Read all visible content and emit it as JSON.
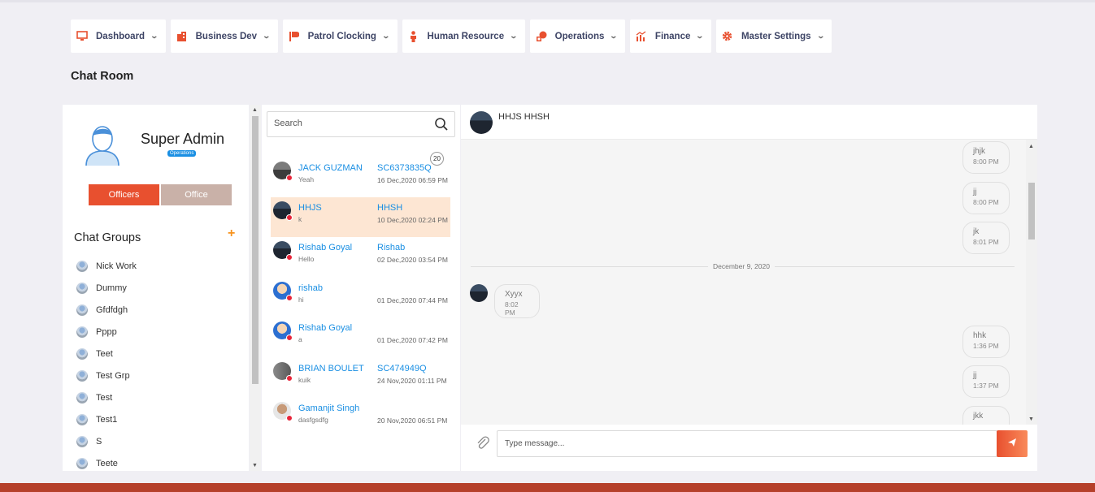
{
  "nav": [
    {
      "label": "Dashboard",
      "icon": "monitor-icon"
    },
    {
      "label": "Business Dev",
      "icon": "building-icon"
    },
    {
      "label": "Patrol Clocking",
      "icon": "flag-icon"
    },
    {
      "label": "Human Resource",
      "icon": "person-icon"
    },
    {
      "label": "Operations",
      "icon": "operations-icon"
    },
    {
      "label": "Finance",
      "icon": "chart-icon"
    },
    {
      "label": "Master Settings",
      "icon": "gear-icon"
    }
  ],
  "page_title": "Chat Room",
  "profile": {
    "name": "Super Admin",
    "role": "Operations"
  },
  "tabs": {
    "officers": "Officers",
    "office": "Office"
  },
  "groups": {
    "title": "Chat Groups",
    "add": "+",
    "items": [
      "Nick Work",
      "Dummy",
      "Gfdfdgh",
      "Pppp",
      "Teet",
      "Test Grp",
      "Test",
      "Test1",
      "S",
      "Teete"
    ]
  },
  "search": {
    "placeholder": "Search"
  },
  "contacts": [
    {
      "name": "JACK GUZMAN",
      "id": "SC6373835Q",
      "msg": "Yeah",
      "date": "16 Dec,2020 06:59 PM",
      "badge": "20"
    },
    {
      "name": "HHJS",
      "id": "HHSH",
      "msg": "k",
      "date": "10 Dec,2020 02:24 PM"
    },
    {
      "name": "Rishab Goyal",
      "id": "Rishab",
      "msg": "Hello",
      "date": "02 Dec,2020 03:54 PM"
    },
    {
      "name": "rishab",
      "id": "",
      "msg": "hi",
      "date": "01 Dec,2020 07:44 PM"
    },
    {
      "name": "Rishab Goyal",
      "id": "",
      "msg": "a",
      "date": "01 Dec,2020 07:42 PM"
    },
    {
      "name": "BRIAN BOULET",
      "id": "SC474949Q",
      "msg": "kuik",
      "date": "24 Nov,2020 01:11 PM"
    },
    {
      "name": "Gamanjit Singh",
      "id": "",
      "msg": "dasfgsdfg",
      "date": "20 Nov,2020 06:51 PM"
    }
  ],
  "chat": {
    "header_name": "HHJS HHSH",
    "date_divider": "December 9, 2020",
    "messages": [
      {
        "text": "jhjk",
        "time": "8:00 PM"
      },
      {
        "text": "jj",
        "time": "8:00 PM"
      },
      {
        "text": "jk",
        "time": "8:01 PM"
      },
      {
        "text": "Xyyx",
        "time": "8:02 PM"
      },
      {
        "text": "hhk",
        "time": "1:36 PM"
      },
      {
        "text": "jj",
        "time": "1:37 PM"
      },
      {
        "text": "jkk",
        "time": ""
      }
    ],
    "composer_placeholder": "Type message..."
  },
  "colors": {
    "accent": "#e8502f",
    "link": "#1a8fe3",
    "active_row": "#fde6d3",
    "footer": "#b5402a"
  }
}
